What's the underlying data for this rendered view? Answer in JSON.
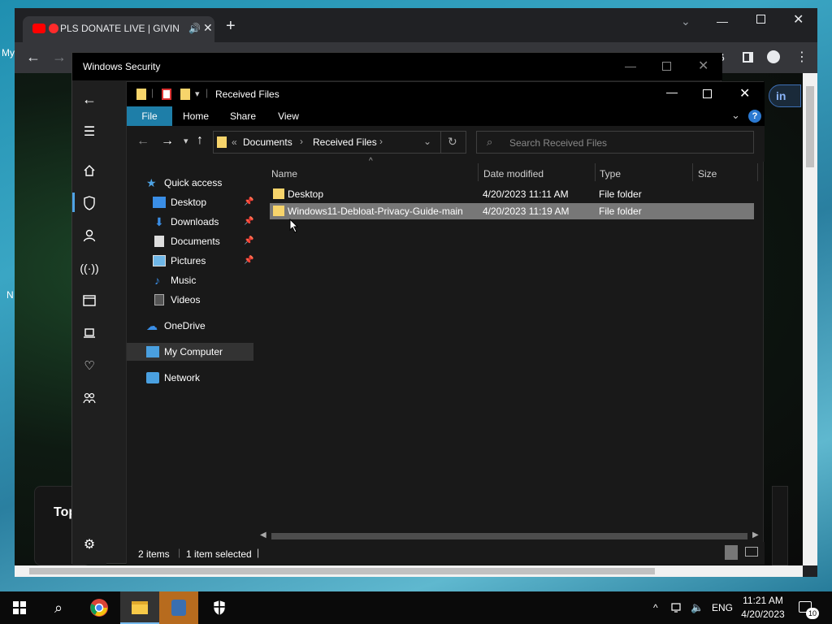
{
  "desktop": {
    "left_label_1": "My",
    "left_label_2": "N"
  },
  "chrome": {
    "tab_title": "PLS DONATE LIVE | GIVIN",
    "page_peek_text": "Top",
    "signin_peek": "in"
  },
  "winsec": {
    "title": "Windows Security"
  },
  "explorer": {
    "title": "Received Files",
    "ribbon": {
      "file": "File",
      "home": "Home",
      "share": "Share",
      "view": "View"
    },
    "breadcrumb": {
      "overflow": "«",
      "part1": "Documents",
      "part2": "Received Files"
    },
    "search_placeholder": "Search Received Files",
    "nav": {
      "quick_access": "Quick access",
      "desktop": "Desktop",
      "downloads": "Downloads",
      "documents": "Documents",
      "pictures": "Pictures",
      "music": "Music",
      "videos": "Videos",
      "onedrive": "OneDrive",
      "my_computer": "My Computer",
      "network": "Network"
    },
    "columns": {
      "name": "Name",
      "date": "Date modified",
      "type": "Type",
      "size": "Size"
    },
    "rows": [
      {
        "name": "Desktop",
        "date": "4/20/2023 11:11 AM",
        "type": "File folder",
        "size": ""
      },
      {
        "name": "Windows11-Debloat-Privacy-Guide-main",
        "date": "4/20/2023 11:19 AM",
        "type": "File folder",
        "size": ""
      }
    ],
    "status": {
      "count": "2 items",
      "selected": "1 item selected"
    }
  },
  "taskbar": {
    "lang": "ENG",
    "time": "11:21 AM",
    "date": "4/20/2023",
    "notif_count": "10"
  },
  "colors": {
    "accent": "#1e7ea8",
    "selection": "#777777",
    "help": "#2b79d1"
  }
}
